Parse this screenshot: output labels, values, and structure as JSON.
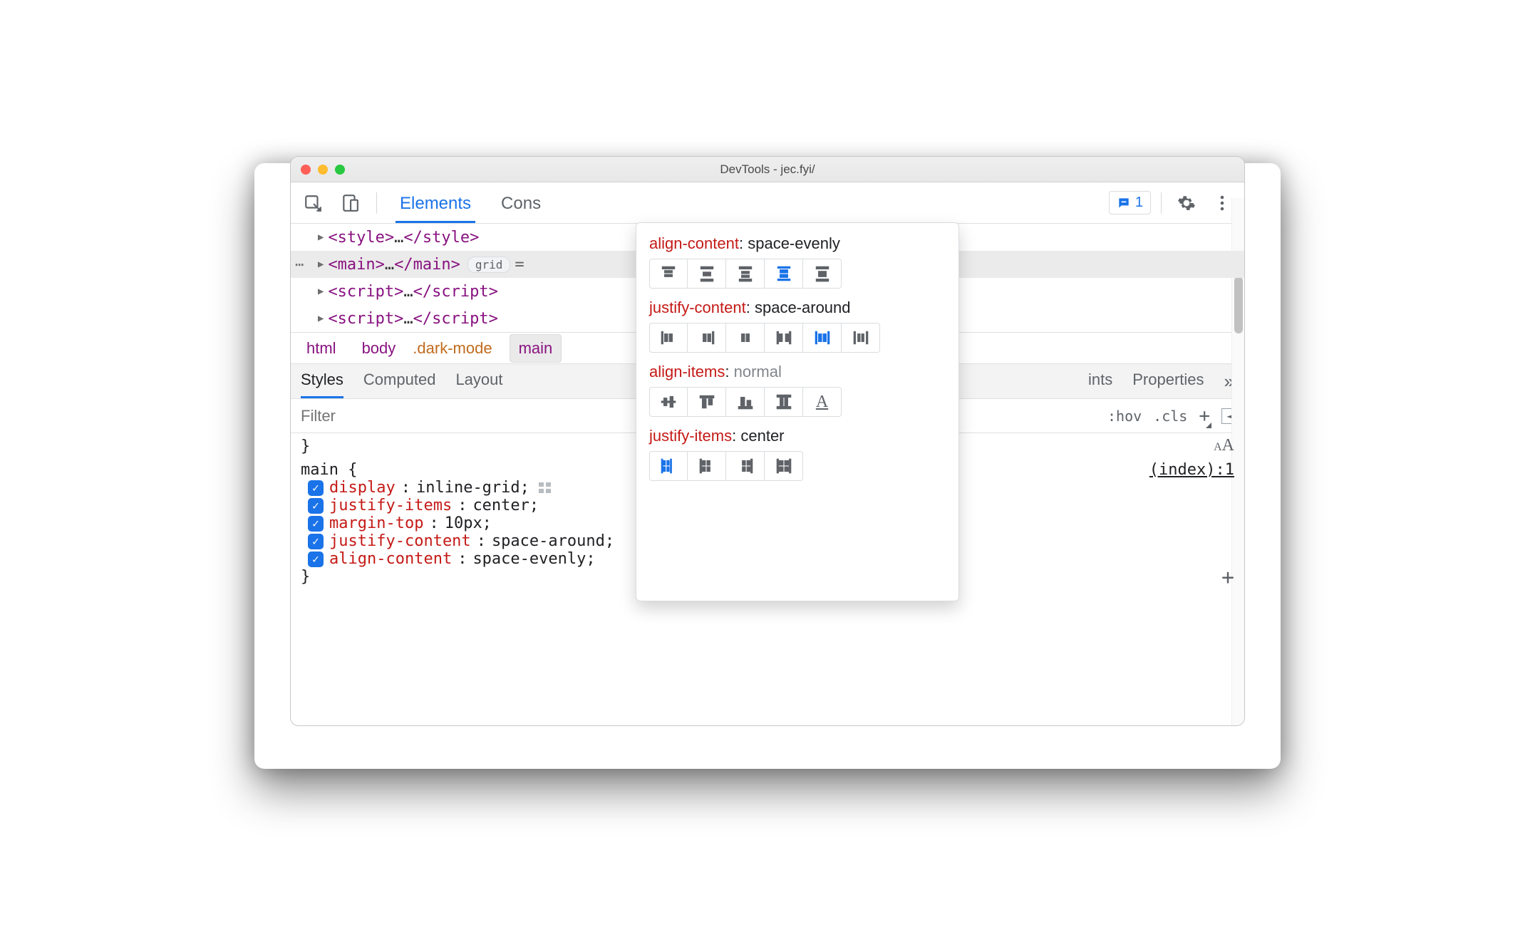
{
  "window": {
    "title": "DevTools - jec.fyi/"
  },
  "toolbar": {
    "tabs": [
      "Elements",
      "Cons"
    ],
    "active_index": 0,
    "issues_count": "1"
  },
  "dom": {
    "rows": [
      {
        "open": "<style>",
        "mid": "…",
        "close": "</style>",
        "selected": false
      },
      {
        "open": "<main>",
        "mid": "…",
        "close": "</main>",
        "selected": true,
        "pill": "grid",
        "eq": "="
      },
      {
        "open": "<script>",
        "mid": "…",
        "close": "</script>",
        "selected": false
      },
      {
        "open": "<script>",
        "mid": "…",
        "close": "</script>",
        "selected": false
      }
    ]
  },
  "breadcrumb": {
    "html": "html",
    "body": "body",
    "body_cls": ".dark-mode",
    "main": "main"
  },
  "subtabs": {
    "items": [
      "Styles",
      "Computed",
      "Layout"
    ],
    "right_partial": "ints",
    "properties": "Properties",
    "active_index": 0
  },
  "filter": {
    "placeholder": "Filter",
    "hov": ":hov",
    "cls": ".cls"
  },
  "rule": {
    "close_brace": "}",
    "selector": "main {",
    "source": "(index):1",
    "end": "}",
    "props": [
      {
        "name": "display",
        "value": "inline-grid;",
        "gridIcon": true
      },
      {
        "name": "justify-items",
        "value": "center;"
      },
      {
        "name": "margin-top",
        "value": "10px;"
      },
      {
        "name": "justify-content",
        "value": "space-around;"
      },
      {
        "name": "align-content",
        "value": "space-evenly;"
      }
    ]
  },
  "flyout": {
    "sections": [
      {
        "key": "align-content",
        "value": "space-evenly",
        "muted": false,
        "selected": 3,
        "set": "align-content"
      },
      {
        "key": "justify-content",
        "value": "space-around",
        "muted": false,
        "selected": 4,
        "set": "justify-content"
      },
      {
        "key": "align-items",
        "value": "normal",
        "muted": true,
        "selected": -1,
        "set": "align-items"
      },
      {
        "key": "justify-items",
        "value": "center",
        "muted": false,
        "selected": 0,
        "set": "justify-items"
      }
    ]
  }
}
